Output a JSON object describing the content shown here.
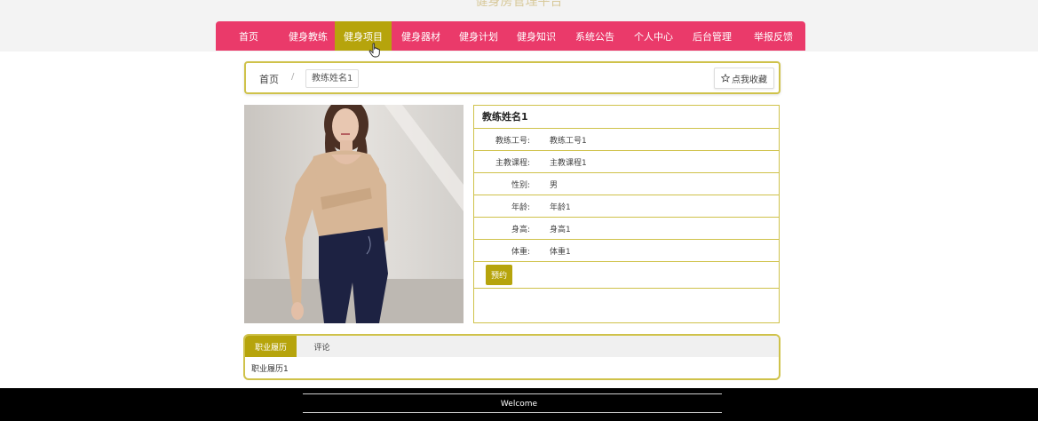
{
  "site": {
    "title": "健身房管理平台"
  },
  "nav": {
    "items": [
      {
        "label": "首页",
        "active": false
      },
      {
        "label": "健身教练",
        "active": false
      },
      {
        "label": "健身项目",
        "active": true
      },
      {
        "label": "健身器材",
        "active": false
      },
      {
        "label": "健身计划",
        "active": false
      },
      {
        "label": "健身知识",
        "active": false
      },
      {
        "label": "系统公告",
        "active": false
      },
      {
        "label": "个人中心",
        "active": false
      },
      {
        "label": "后台管理",
        "active": false
      },
      {
        "label": "举报反馈",
        "active": false
      }
    ]
  },
  "breadcrumb": {
    "home": "首页",
    "separator": "/",
    "current": "教练姓名1"
  },
  "favorite_button": {
    "icon": "star-outline-icon",
    "label": "点我收藏"
  },
  "coach": {
    "name": "教练姓名1",
    "fields": [
      {
        "label": "教练工号:",
        "value": "教练工号1"
      },
      {
        "label": "主教课程:",
        "value": "主教课程1"
      },
      {
        "label": "性别:",
        "value": "男"
      },
      {
        "label": "年龄:",
        "value": "年龄1"
      },
      {
        "label": "身高:",
        "value": "身高1"
      },
      {
        "label": "体重:",
        "value": "体重1"
      }
    ],
    "book_label": "预约"
  },
  "tabs": {
    "items": [
      {
        "label": "职业履历",
        "active": true
      },
      {
        "label": "评论",
        "active": false
      }
    ],
    "content": "职业履历1"
  },
  "footer": {
    "text": "Welcome"
  },
  "colors": {
    "nav_bg": "#ea3a6a",
    "accent": "#b6a40c",
    "border": "#cfc24a",
    "footer_bg": "#000000"
  }
}
